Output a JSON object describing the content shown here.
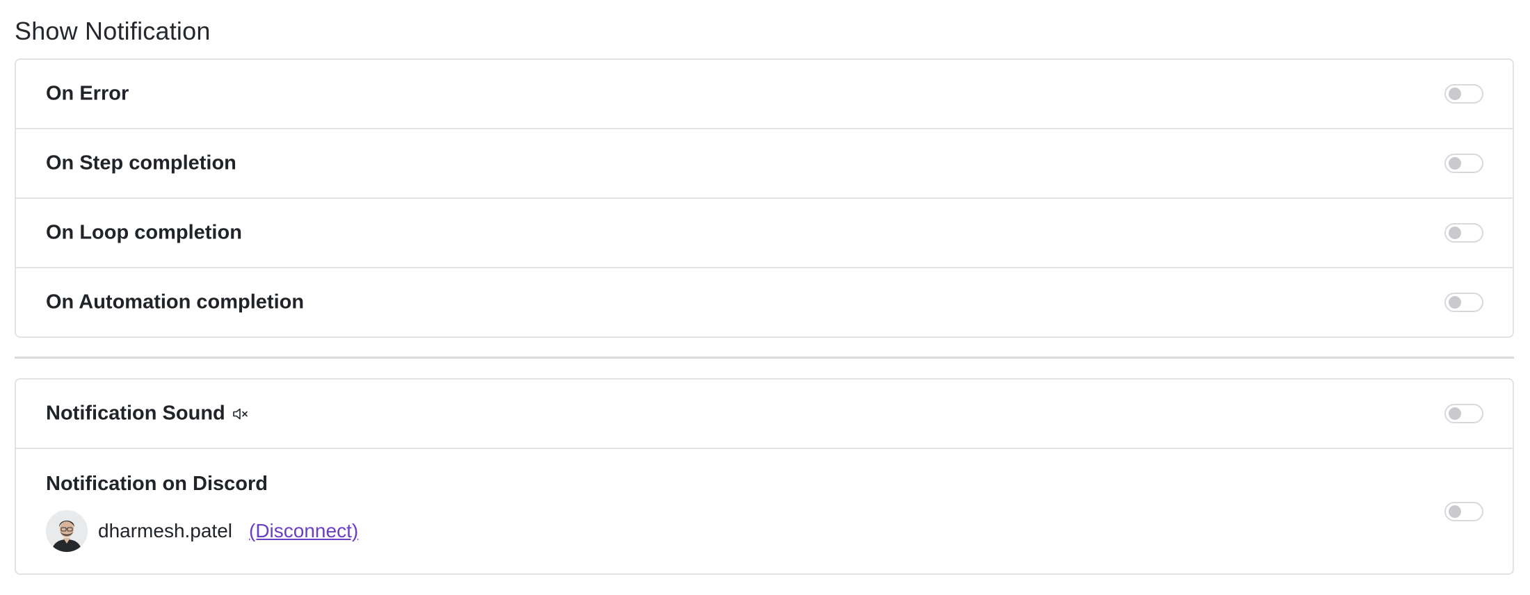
{
  "page": {
    "title": "Show Notification"
  },
  "notifications": {
    "items": [
      {
        "label": "On Error",
        "enabled": false
      },
      {
        "label": "On Step completion",
        "enabled": false
      },
      {
        "label": "On Loop completion",
        "enabled": false
      },
      {
        "label": "On Automation completion",
        "enabled": false
      }
    ]
  },
  "sound": {
    "label": "Notification Sound",
    "icon": "mute-icon",
    "enabled": false
  },
  "discord": {
    "label": "Notification on Discord",
    "username": "dharmesh.patel",
    "disconnect_label": "(Disconnect)",
    "enabled": false
  },
  "colors": {
    "link": "#6a3fc4",
    "border": "#e2e3e5",
    "toggle_knob": "#c8cacd"
  }
}
